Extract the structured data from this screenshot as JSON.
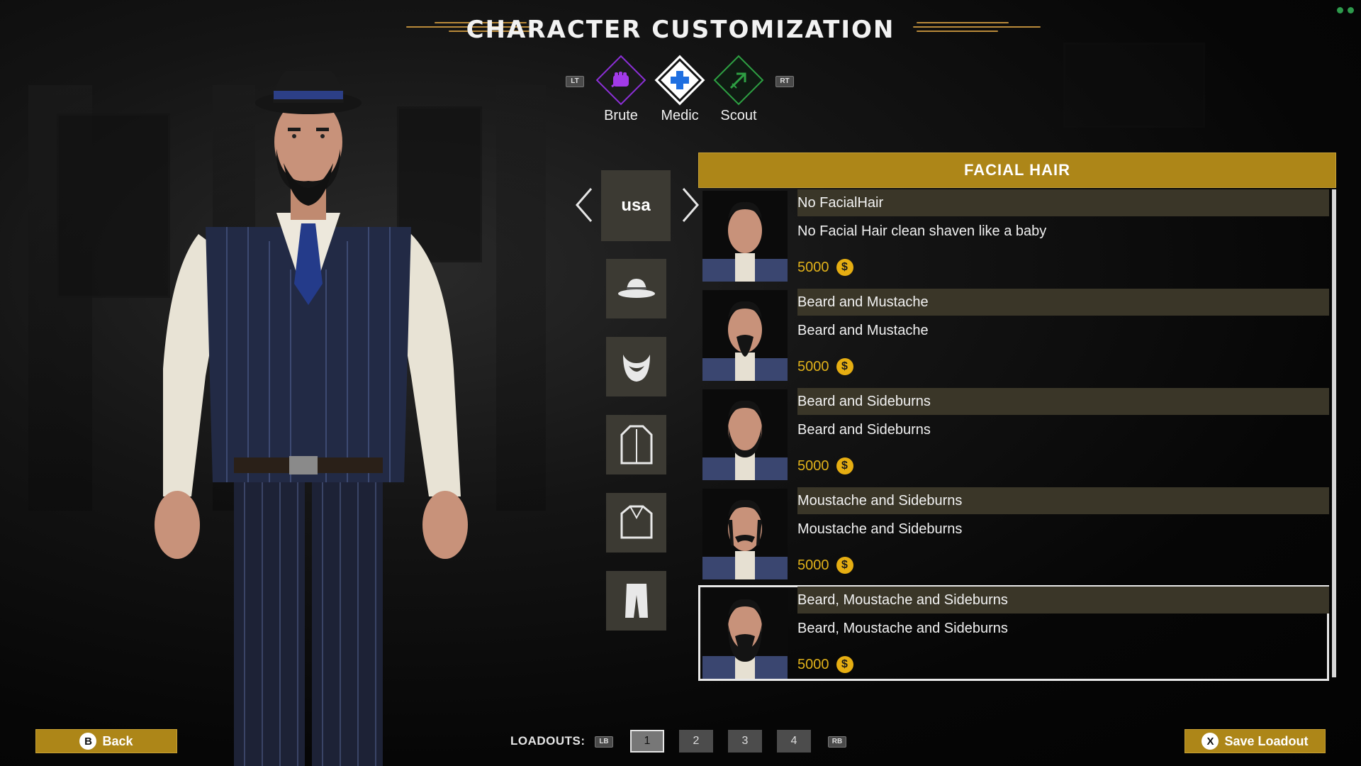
{
  "title": "CHARACTER CUSTOMIZATION",
  "class_selector": {
    "prev_trigger": "LT",
    "next_trigger": "RT",
    "classes": [
      {
        "label": "Brute",
        "icon": "fist-icon",
        "color": "#8b2fd6"
      },
      {
        "label": "Medic",
        "icon": "medical-cross-icon",
        "color": "#1f6fe0"
      },
      {
        "label": "Scout",
        "icon": "arrow-icon",
        "color": "#2ea043"
      }
    ],
    "selected": "Medic"
  },
  "category": {
    "current": "usa",
    "items": [
      "hat-icon",
      "beard-icon",
      "coat-icon",
      "jacket-icon",
      "pants-icon"
    ]
  },
  "panel": {
    "header": "FACIAL HAIR",
    "currency_icon": "dollar-coin-icon",
    "items": [
      {
        "name": "No FacialHair",
        "desc": "No Facial Hair clean shaven like a baby",
        "price": "5000"
      },
      {
        "name": "Beard and Mustache",
        "desc": "Beard and Mustache",
        "price": "5000"
      },
      {
        "name": "Beard and Sideburns",
        "desc": "Beard and Sideburns",
        "price": "5000"
      },
      {
        "name": "Moustache and Sideburns",
        "desc": "Moustache and Sideburns",
        "price": "5000"
      },
      {
        "name": "Beard, Moustache and Sideburns",
        "desc": "Beard, Moustache and Sideburns",
        "price": "5000"
      }
    ],
    "selected_index": 4
  },
  "coin_symbol": "$",
  "footer": {
    "back_key": "B",
    "back_label": "Back",
    "loadouts_label": "LOADOUTS:",
    "prev_bumper": "LB",
    "next_bumper": "RB",
    "slots": [
      "1",
      "2",
      "3",
      "4"
    ],
    "active_slot": "1",
    "save_key": "X",
    "save_label": "Save Loadout"
  }
}
